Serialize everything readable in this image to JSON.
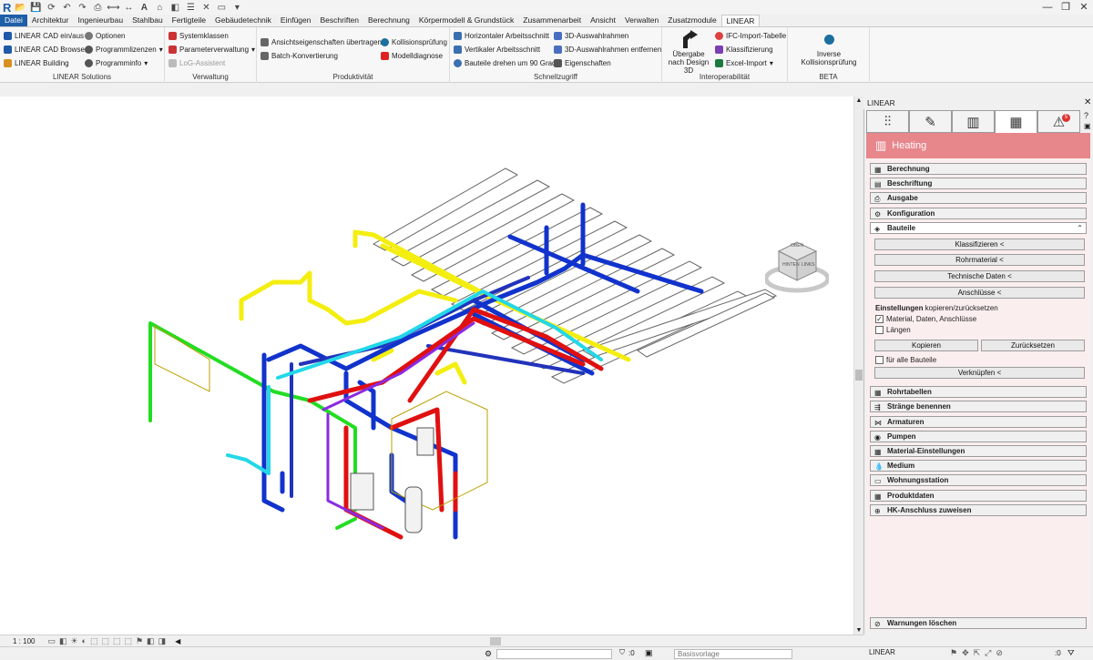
{
  "quick_access": {
    "logo": "R"
  },
  "tabs": [
    "Datei",
    "Architektur",
    "Ingenieurbau",
    "Stahlbau",
    "Fertigteile",
    "Gebäudetechnik",
    "Einfügen",
    "Beschriften",
    "Berechnung",
    "Körpermodell & Grundstück",
    "Zusammenarbeit",
    "Ansicht",
    "Verwalten",
    "Zusatzmodule",
    "LINEAR"
  ],
  "ribbon": {
    "linear_solutions": {
      "title": "LINEAR Solutions",
      "items": [
        "LINEAR CAD ein/aus",
        "LINEAR CAD Browser",
        "LINEAR Building",
        "Optionen",
        "Programmlizenzen",
        "Programminfo"
      ]
    },
    "verwaltung": {
      "title": "Verwaltung",
      "items": [
        "Systemklassen",
        "Parameterverwaltung",
        "LoG-Assistent"
      ]
    },
    "produktivitaet": {
      "title": "Produktivität",
      "items": [
        "Ansichtseigenschaften übertragen",
        "Batch-Konvertierung",
        "Kollisionsprüfung",
        "Modelldiagnose"
      ]
    },
    "schnellzugriff": {
      "title": "Schnellzugriff",
      "items": [
        "Horizontaler Arbeitsschnitt",
        "Vertikaler Arbeitsschnitt",
        "Bauteile drehen um 90 Grad",
        "3D-Auswahlrahmen",
        "3D-Auswahlrahmen entfernen",
        "Eigenschaften"
      ]
    },
    "interoperabilitaet": {
      "title": "Interoperabilität",
      "big": "Übergabe nach Design 3D",
      "items": [
        "IFC-Import-Tabelle",
        "Klassifizierung",
        "Excel-Import"
      ]
    },
    "beta": {
      "title": "BETA",
      "big": "Inverse Kollisionsprüfung"
    }
  },
  "viewcube": {
    "top": "OBEN",
    "front": "HINTEN",
    "right": "LINKS"
  },
  "status": {
    "scale": "1 : 100",
    "coord": ":0",
    "basis": "Basisvorlage",
    "right_coord": ":0"
  },
  "panel": {
    "title": "LINEAR",
    "badge": "5",
    "header": "Heating",
    "sections_top": [
      "Berechnung",
      "Beschriftung",
      "Ausgabe",
      "Konfiguration",
      "Bauteile"
    ],
    "bauteile_buttons": [
      "Klassifizieren  <",
      "Rohrmaterial  <",
      "Technische Daten  <",
      "Anschlüsse  <"
    ],
    "einstellungen_bold": "Einstellungen",
    "einstellungen_rest": " kopieren/zurücksetzen",
    "opt1": "Material, Daten, Anschlüsse",
    "opt2": "Längen",
    "kopieren": "Kopieren",
    "zuruecksetzen": "Zurücksetzen",
    "alle": "für alle Bauteile",
    "verknuepfen": "Verknüpfen  <",
    "sections_bottom": [
      "Rohrtabellen",
      "Stränge benennen",
      "Armaturen",
      "Pumpen",
      "Material-Einstellungen",
      "Medium",
      "Wohnungsstation",
      "Produktdaten",
      "HK-Anschluss zuweisen"
    ],
    "warnungen": "Warnungen löschen",
    "footer": "LINEAR"
  },
  "colors": {
    "file_tab": "#1f5fa7",
    "heating": "#e7868b",
    "pipe_blue": "#1133cc",
    "pipe_red": "#e01010",
    "pipe_yellow": "#f4ee10",
    "pipe_cyan": "#22d8e8",
    "pipe_green": "#22dd22",
    "pipe_purple": "#8a2be2"
  }
}
